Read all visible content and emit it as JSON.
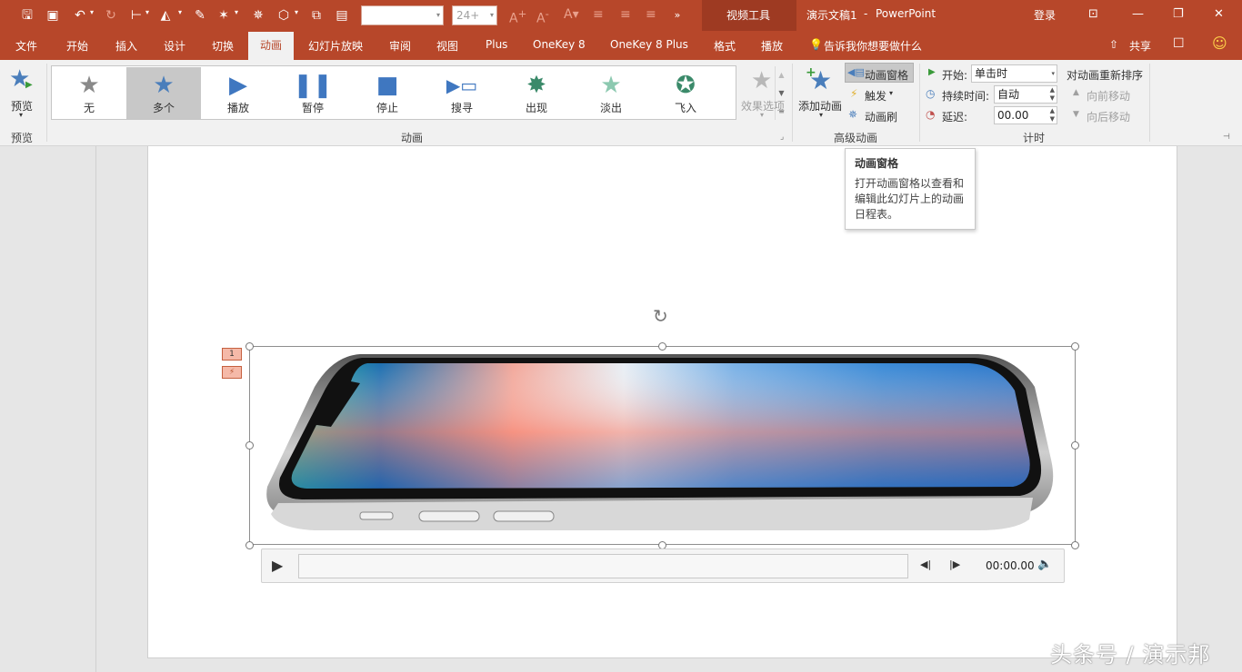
{
  "title": {
    "context_tools": "视频工具",
    "document": "演示文稿1",
    "separator": "-",
    "app": "PowerPoint",
    "login": "登录"
  },
  "quick_access": {
    "font_size_value": "24+",
    "font_name_value": ""
  },
  "tabs": [
    "文件",
    "开始",
    "插入",
    "设计",
    "切换",
    "动画",
    "幻灯片放映",
    "审阅",
    "视图",
    "Plus",
    "OneKey 8",
    "OneKey 8 Plus",
    "格式",
    "播放"
  ],
  "active_tab": "动画",
  "tell_me": "告诉我你想要做什么",
  "share": "共享",
  "ribbon": {
    "preview": {
      "label": "预览",
      "group": "预览"
    },
    "animation_gallery": [
      {
        "label": "无",
        "icon": "star-gray-icon"
      },
      {
        "label": "多个",
        "icon": "star-blue-icon",
        "selected": true
      },
      {
        "label": "播放",
        "icon": "play-icon"
      },
      {
        "label": "暂停",
        "icon": "pause-icon"
      },
      {
        "label": "停止",
        "icon": "stop-icon"
      },
      {
        "label": "搜寻",
        "icon": "seek-icon"
      },
      {
        "label": "出现",
        "icon": "appear-icon"
      },
      {
        "label": "淡出",
        "icon": "fade-icon"
      },
      {
        "label": "飞入",
        "icon": "fly-in-icon"
      }
    ],
    "effect_options": "效果选项",
    "animation_group": "动画",
    "add_animation": "添加动画",
    "animation_pane": "动画窗格",
    "trigger": "触发",
    "animation_painter": "动画刷",
    "advanced_group": "高级动画",
    "timing": {
      "start_label": "开始:",
      "start_value": "单击时",
      "duration_label": "持续时间:",
      "duration_value": "自动",
      "delay_label": "延迟:",
      "delay_value": "00.00",
      "reorder": "对动画重新排序",
      "move_earlier": "向前移动",
      "move_later": "向后移动",
      "group": "计时"
    }
  },
  "tooltip": {
    "title": "动画窗格",
    "body": "打开动画窗格以查看和编辑此幻灯片上的动画日程表。"
  },
  "media": {
    "anim_tag_1": "1",
    "time": "00:00.00"
  },
  "watermark": "头条号 / 演示邦",
  "colors": {
    "accent": "#b7472a",
    "context": "#9e3a22",
    "star_blue": "#4a7ebb"
  }
}
